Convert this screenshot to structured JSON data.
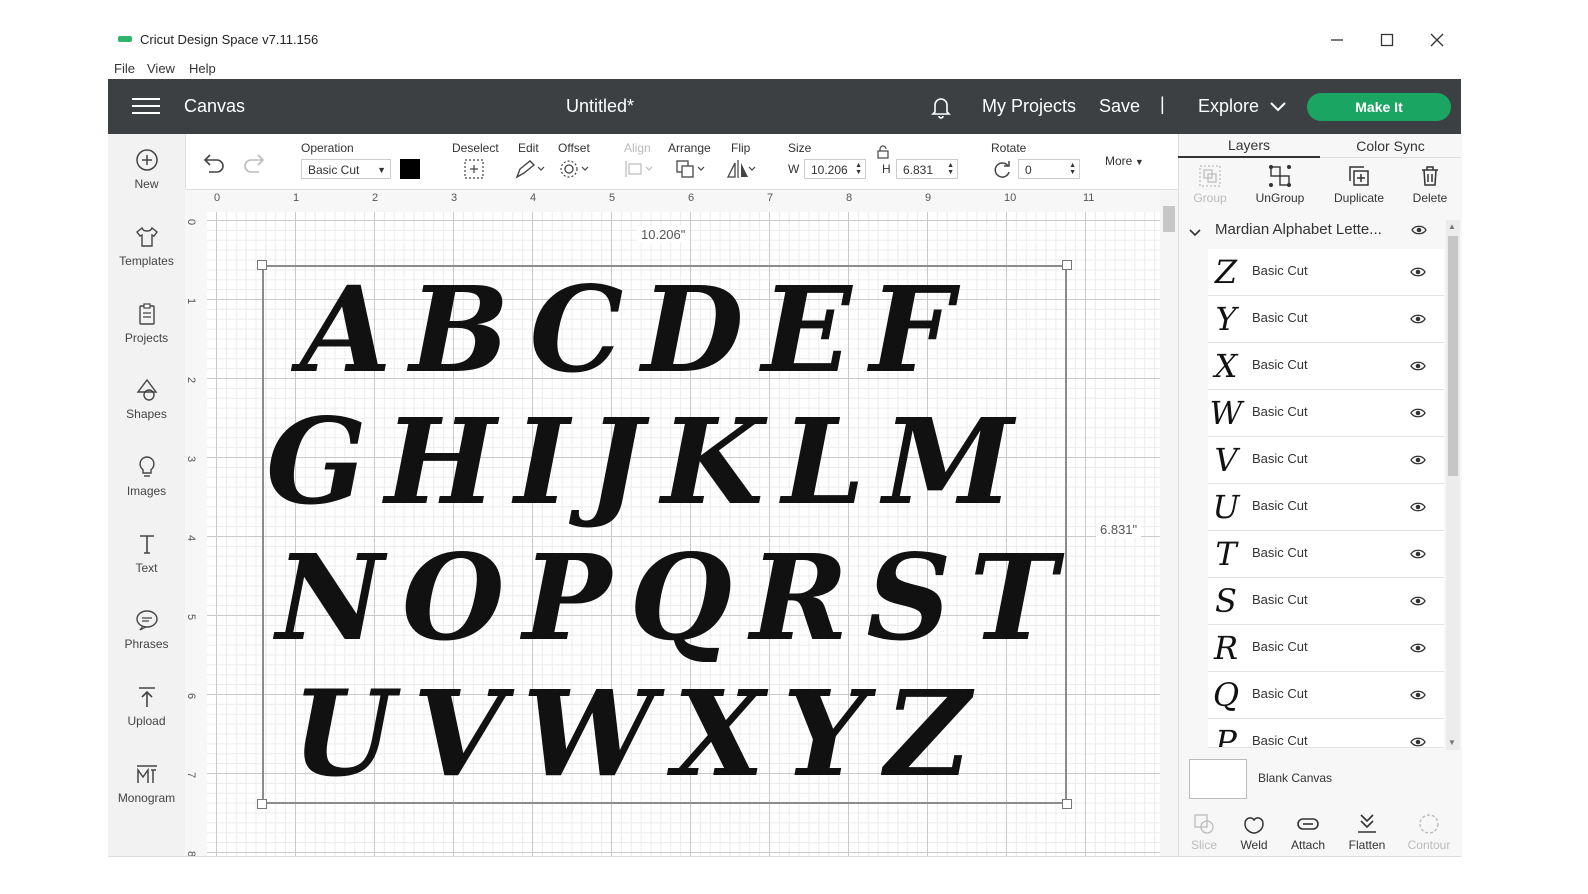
{
  "window": {
    "title": "Cricut Design Space  v7.11.156",
    "controls": [
      "—",
      "☐",
      "✕"
    ]
  },
  "menu": {
    "file": "File",
    "view": "View",
    "help": "Help"
  },
  "header": {
    "canvas": "Canvas",
    "title": "Untitled*",
    "my_projects": "My Projects",
    "save": "Save",
    "separator": "|",
    "explore": "Explore",
    "make_it": "Make It",
    "make_it_color": "#1aa562"
  },
  "sidebar": {
    "items": [
      {
        "label": "New",
        "icon": "plus-circle-icon"
      },
      {
        "label": "Templates",
        "icon": "tshirt-icon"
      },
      {
        "label": "Projects",
        "icon": "clipboard-icon"
      },
      {
        "label": "Shapes",
        "icon": "shapes-icon"
      },
      {
        "label": "Images",
        "icon": "lightbulb-icon"
      },
      {
        "label": "Text",
        "icon": "text-t-icon"
      },
      {
        "label": "Phrases",
        "icon": "speech-bubble-icon"
      },
      {
        "label": "Upload",
        "icon": "upload-arrow-icon"
      },
      {
        "label": "Monogram",
        "icon": "monogram-icon"
      }
    ]
  },
  "toolbar": {
    "operation_label": "Operation",
    "operation_value": "Basic Cut",
    "operation_color": "#000000",
    "deselect": "Deselect",
    "edit": "Edit",
    "offset": "Offset",
    "align": "Align",
    "arrange": "Arrange",
    "flip": "Flip",
    "size": "Size",
    "w_label": "W",
    "w_value": "10.206",
    "h_label": "H",
    "h_value": "6.831",
    "rotate": "Rotate",
    "rotate_value": "0",
    "more": "More"
  },
  "canvas": {
    "ruler_top": [
      "0",
      "1",
      "2",
      "3",
      "4",
      "5",
      "6",
      "7",
      "8",
      "9",
      "10",
      "11"
    ],
    "ruler_left": [
      "0",
      "1",
      "2",
      "3",
      "4",
      "5",
      "6",
      "7",
      "8"
    ],
    "width_readout": "10.206\"",
    "height_readout": "6.831\"",
    "letter_rows": [
      "ABCDEF",
      "GHIJKLM",
      "NOPQRST",
      "UVWXYZ"
    ]
  },
  "layers_panel": {
    "tab_layers": "Layers",
    "tab_color_sync": "Color Sync",
    "actions": [
      {
        "label": "Group",
        "icon": "group-icon",
        "enabled": false
      },
      {
        "label": "UnGroup",
        "icon": "ungroup-icon",
        "enabled": true
      },
      {
        "label": "Duplicate",
        "icon": "duplicate-icon",
        "enabled": true
      },
      {
        "label": "Delete",
        "icon": "trash-icon",
        "enabled": true
      }
    ],
    "group_name": "Mardian Alphabet Lette...",
    "layers": [
      {
        "glyph": "Z",
        "name": "Basic Cut"
      },
      {
        "glyph": "Y",
        "name": "Basic Cut"
      },
      {
        "glyph": "X",
        "name": "Basic Cut"
      },
      {
        "glyph": "W",
        "name": "Basic Cut"
      },
      {
        "glyph": "V",
        "name": "Basic Cut"
      },
      {
        "glyph": "U",
        "name": "Basic Cut"
      },
      {
        "glyph": "T",
        "name": "Basic Cut"
      },
      {
        "glyph": "S",
        "name": "Basic Cut"
      },
      {
        "glyph": "R",
        "name": "Basic Cut"
      },
      {
        "glyph": "Q",
        "name": "Basic Cut"
      },
      {
        "glyph": "P",
        "name": "Basic Cut"
      }
    ],
    "blank_canvas": "Blank Canvas",
    "bottom_actions": [
      {
        "label": "Slice",
        "icon": "slice-icon",
        "enabled": false
      },
      {
        "label": "Weld",
        "icon": "weld-icon",
        "enabled": true
      },
      {
        "label": "Attach",
        "icon": "attach-icon",
        "enabled": true
      },
      {
        "label": "Flatten",
        "icon": "flatten-icon",
        "enabled": true
      },
      {
        "label": "Contour",
        "icon": "contour-icon",
        "enabled": false
      }
    ]
  }
}
